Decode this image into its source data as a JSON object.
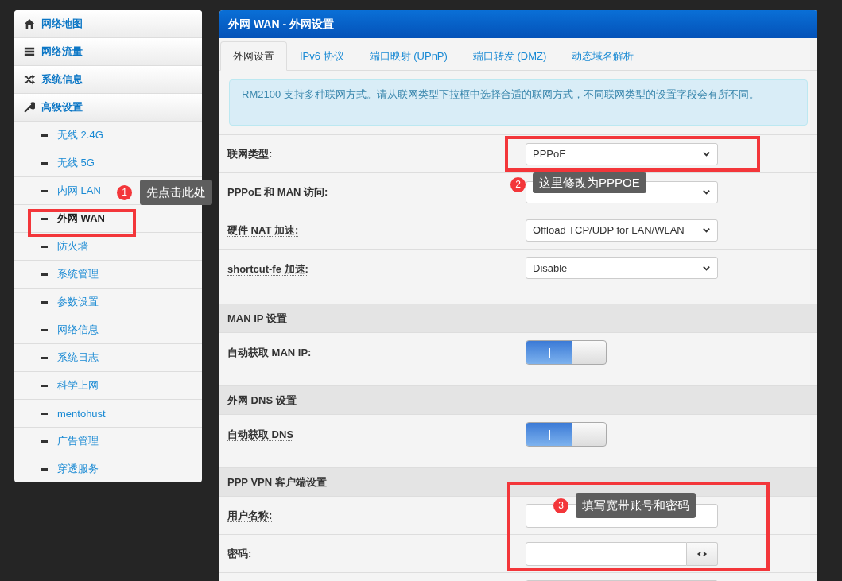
{
  "sidebar": {
    "items": [
      {
        "label": "网络地图",
        "kind": "section",
        "selected": false
      },
      {
        "label": "网络流量",
        "kind": "section",
        "selected": false
      },
      {
        "label": "系统信息",
        "kind": "section",
        "selected": false
      },
      {
        "label": "高级设置",
        "kind": "section",
        "selected": false
      },
      {
        "label": "无线 2.4G",
        "kind": "sub",
        "selected": false
      },
      {
        "label": "无线 5G",
        "kind": "sub",
        "selected": false
      },
      {
        "label": "内网 LAN",
        "kind": "sub",
        "selected": false
      },
      {
        "label": "外网 WAN",
        "kind": "sub",
        "selected": true
      },
      {
        "label": "防火墙",
        "kind": "sub",
        "selected": false
      },
      {
        "label": "系统管理",
        "kind": "sub",
        "selected": false
      },
      {
        "label": "参数设置",
        "kind": "sub",
        "selected": false
      },
      {
        "label": "网络信息",
        "kind": "sub",
        "selected": false
      },
      {
        "label": "系统日志",
        "kind": "sub",
        "selected": false
      },
      {
        "label": "科学上网",
        "kind": "sub",
        "selected": false
      },
      {
        "label": "mentohust",
        "kind": "sub",
        "selected": false
      },
      {
        "label": "广告管理",
        "kind": "sub",
        "selected": false
      },
      {
        "label": "穿透服务",
        "kind": "sub",
        "selected": false
      }
    ]
  },
  "panel": {
    "title": "外网 WAN - 外网设置",
    "tabs": [
      {
        "label": "外网设置",
        "selected": true
      },
      {
        "label": "IPv6 协议",
        "selected": false
      },
      {
        "label": "端口映射 (UPnP)",
        "selected": false
      },
      {
        "label": "端口转发 (DMZ)",
        "selected": false
      },
      {
        "label": "动态域名解析",
        "selected": false
      }
    ],
    "notice": "RM2100 支持多种联网方式。请从联网类型下拉框中选择合适的联网方式，不同联网类型的设置字段会有所不同。",
    "rows": [
      {
        "kind": "select",
        "label": "联网类型:",
        "hint": false,
        "value": "PPPoE"
      },
      {
        "kind": "select",
        "label": "PPPoE 和 MAN 访问:",
        "hint": false
      },
      {
        "kind": "select",
        "label": "硬件 NAT 加速:",
        "hint": true,
        "value": "Offload TCP/UDP for LAN/WLAN"
      },
      {
        "kind": "select",
        "label": "shortcut-fe 加速:",
        "hint": true,
        "value": "Disable"
      },
      {
        "kind": "section",
        "label": "MAN IP 设置"
      },
      {
        "kind": "toggle",
        "label": "自动获取 MAN IP:",
        "hint": false,
        "on": true
      },
      {
        "kind": "section",
        "label": "外网 DNS 设置"
      },
      {
        "kind": "toggle",
        "label": "自动获取 DNS",
        "hint": true,
        "on": true
      },
      {
        "kind": "section",
        "label": "PPP VPN 客户端设置"
      },
      {
        "kind": "text",
        "label": "用户名称:",
        "hint": true
      },
      {
        "kind": "password",
        "label": "密码:",
        "hint": true
      },
      {
        "kind": "text"
      }
    ]
  },
  "annotations": [
    {
      "step": "1",
      "text": "先点击此处"
    },
    {
      "step": "2",
      "text": "这里修改为PPPOE"
    },
    {
      "step": "3",
      "text": "填写宽带账号和密码"
    }
  ]
}
